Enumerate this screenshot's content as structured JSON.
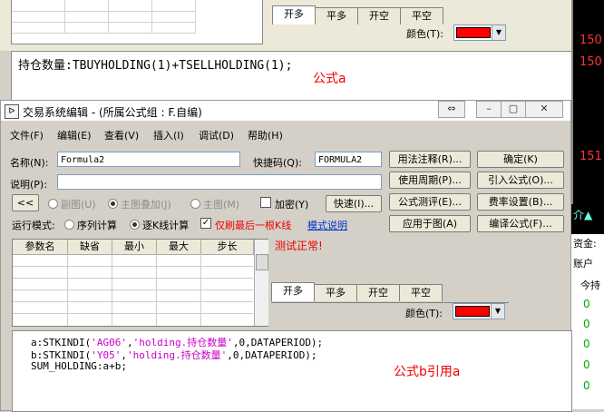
{
  "background_window": {
    "tabs": [
      "开多",
      "平多",
      "开空",
      "平空"
    ],
    "color_label": "颜色(T):",
    "color_value": "#ff0000",
    "formula": "持仓数量:TBUYHOLDING(1)+TSELLHOLDING(1);",
    "note": "公式a"
  },
  "right_panel": {
    "values": [
      "150",
      "150",
      "151"
    ],
    "zijin": "资金:",
    "zhanghu": "账户",
    "jinchi": "今持",
    "zeros": [
      "0",
      "0",
      "0",
      "0",
      "0"
    ],
    "arrows": "介▲"
  },
  "dialog": {
    "title": "交易系统编辑 - (所属公式组 : F.自编)",
    "window_buttons": {
      "resize": "⇔",
      "minimize": "–",
      "restore": "▢",
      "close": "✕"
    },
    "menu": [
      "文件(F)",
      "编辑(E)",
      "查看(V)",
      "插入(I)",
      "调试(D)",
      "帮助(H)"
    ],
    "name_label": "名称(N):",
    "name_value": "Formula2",
    "code_label": "快捷码(Q):",
    "code_value": "FORMULA2",
    "desc_label": "说明(P):",
    "desc_value": "",
    "collapse_btn": "<<",
    "radios": [
      {
        "label": "副图(U)",
        "on": false
      },
      {
        "label": "主图叠加(J)",
        "on": true
      },
      {
        "label": "主图(M)",
        "on": false
      }
    ],
    "encrypt_label": "加密(Y)",
    "quick_btn": "快速(I)...",
    "run_mode_label": "运行模式:",
    "run_modes": [
      {
        "label": "序列计算",
        "on": false
      },
      {
        "label": "逐K线计算",
        "on": true
      }
    ],
    "last_bar_label": "仅刷最后一根K线",
    "mode_help_link": "模式说明",
    "right_buttons": [
      "用法注释(R)...",
      "确定(K)",
      "使用周期(P)...",
      "引入公式(O)...",
      "公式测评(E)...",
      "费率设置(B)...",
      "应用于图(A)",
      "编译公式(F)..."
    ],
    "param_headers": [
      "参数名",
      "缺省",
      "最小",
      "最大",
      "步长"
    ],
    "test_status": "测试正常!",
    "tabs": [
      "开多",
      "平多",
      "开空",
      "平空"
    ],
    "color_label": "颜色(T):",
    "color_value": "#ff0000",
    "code_lines": [
      [
        "a:STKINDI(",
        "'AG06'",
        ",",
        "'holding.持仓数量'",
        ",0,DATAPERIOD);"
      ],
      [
        "b:STKINDI(",
        "'Y05'",
        ",",
        "'holding.持仓数量'",
        ",0,DATAPERIOD);"
      ],
      [
        "SUM_HOLDING:a+b;",
        "",
        "",
        "",
        ""
      ]
    ],
    "note": "公式b引用a"
  }
}
